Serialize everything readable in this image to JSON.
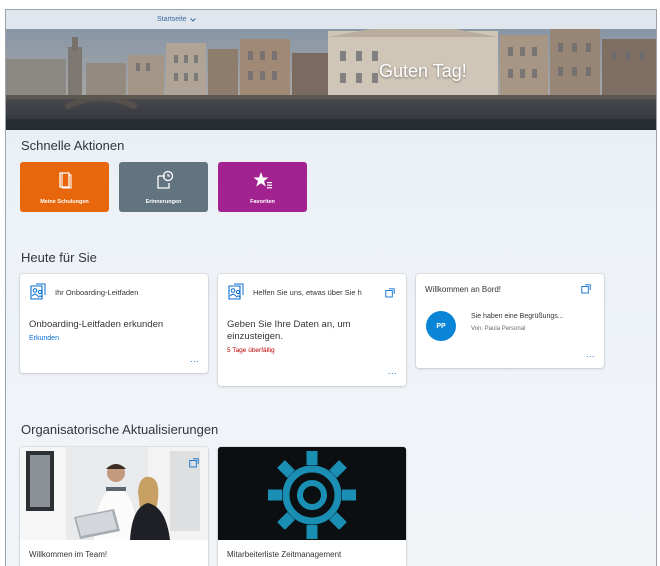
{
  "topbar": {
    "nav_label": "Startseite"
  },
  "hero": {
    "greeting": "Guten Tag!"
  },
  "quick_actions": {
    "title": "Schnelle Aktionen",
    "tiles": [
      {
        "label": "Meine Schulungen",
        "color": "#e8670c",
        "icon": "book-icon"
      },
      {
        "label": "Erinnerungen",
        "color": "#637481",
        "icon": "reminder-clock-icon"
      },
      {
        "label": "Favoriten",
        "color": "#a2238f",
        "icon": "star-list-icon"
      }
    ]
  },
  "today": {
    "title": "Heute für Sie",
    "cards": [
      {
        "header": "Ihr Onboarding-Leitfaden",
        "title": "Onboarding-Leitfaden erkunden",
        "link": "Erkunden",
        "more": "..."
      },
      {
        "header": "Helfen Sie uns, etwas über Sie h",
        "title_line1": "Geben Sie Ihre Daten an, um",
        "title_line2": "einzusteigen.",
        "status": "5 Tage überfällig",
        "more": "..."
      },
      {
        "header": "Willkommen an Bord!",
        "avatar_initials": "PP",
        "message": "Sie haben eine Begrüßungs...",
        "sender": "Von: Paula Personal",
        "more": "..."
      }
    ]
  },
  "org_updates": {
    "title": "Organisatorische Aktualisierungen",
    "cards": [
      {
        "caption": "Willkommen im Team!"
      },
      {
        "caption": "Mitarbeiterliste Zeitmanagement"
      }
    ]
  },
  "colors": {
    "accent_blue": "#0a6ed1",
    "overdue_red": "#bb0000",
    "avatar_blue": "#0a84d6"
  }
}
